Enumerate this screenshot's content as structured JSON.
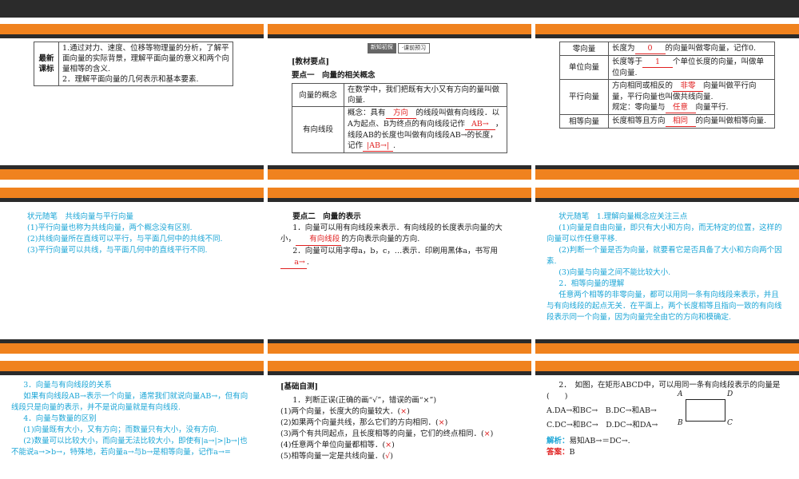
{
  "p1": {
    "label": "最新课标",
    "line1": "1.通过对力、速度、位移等物理量的分析，了解平面向量的实际背景，理解平面向量的意义和两个向量相等的含义.",
    "line2": "2．理解平面向量的几何表示和基本要素."
  },
  "p2": {
    "banner_a": "新知初探",
    "banner_b": "·课前预习",
    "heading": "[教材要点]",
    "point": "要点一　向量的相关概念",
    "row1_h": "向量的概念",
    "row1_v": "在数学中，我们把既有大小又有方向的量叫做向量.",
    "row2_h": "有向线段",
    "row2_a": "概念：具有",
    "row2_fill1": "方向",
    "row2_b": "的线段叫做有向线段．以A为起点、B为终点的有向线段记作",
    "row2_fill2": "AB→",
    "row2_c": "，线段AB的长度也叫做有向线段AB→的长度，记作",
    "row2_fill3": "|AB→|",
    "row2_d": "."
  },
  "p3": {
    "r1_h": "零向量",
    "r1_a": "长度为",
    "r1_f": "0",
    "r1_b": "的向量叫做零向量，记作0.",
    "r2_h": "单位向量",
    "r2_a": "长度等于",
    "r2_f": "1",
    "r2_b": "个单位长度的向量，叫做单位向量.",
    "r3_h": "平行向量",
    "r3_a": "方向相同或相反的",
    "r3_f": "非零",
    "r3_b": "向量叫做平行向量，平行向量也叫做共线向量.",
    "r3_c": "规定：零向量与",
    "r3_f2": "任意",
    "r3_d": "向量平行.",
    "r4_h": "相等向量",
    "r4_a": "长度相等且方向",
    "r4_f": "相同",
    "r4_b": "的向量叫做相等向量."
  },
  "p4": {
    "title": "状元随笔　共线向量与平行向量",
    "l1": "(1)平行向量也称为共线向量，两个概念没有区别.",
    "l2": "(2)共线向量所在直线可以平行，与平面几何中的共线不同.",
    "l3": "(3)平行向量可以共线，与平面几何中的直线平行不同."
  },
  "p5": {
    "title": "要点二　向量的表示",
    "l1a": "1．向量可以用有向线段来表示．有向线段的长度表示向量的大小，",
    "l1f": "有向线段",
    "l1b": "的方向表示向量的方向.",
    "l2": "2．向量可以用字母a，b，c，…表示．印刷用黑体a，书写用",
    "l2f": "a→",
    "l2b": "."
  },
  "p6": {
    "title": "状元随笔　1.理解向量概念应关注三点",
    "l1": "(1)向量是自由向量，即只有大小和方向，而无特定的位置，这样的向量可以作任意平移.",
    "l2": "(2)判断一个量是否为向量，就要看它是否具备了大小和方向两个因素.",
    "l3": "(3)向量与向量之间不能比较大小.",
    "l4": "2．相等向量的理解",
    "l5": "任意两个相等的非零向量，都可以用同一条有向线段来表示，并且与有向线段的起点无关．在平面上，两个长度相等且指向一致的有向线段表示同一个向量，因为向量完全由它的方向和模确定."
  },
  "p7": {
    "l1": "3．向量与有向线段的关系",
    "l2": "如果有向线段AB→表示一个向量，通常我们就说向量AB→，但有向线段只是向量的表示，并不是说向量就是有向线段.",
    "l3": "4．向量与数量的区别",
    "l4": "(1)向量既有大小，又有方向；而数量只有大小，没有方向.",
    "l5": "(2)数量可以比较大小，而向量无法比较大小，即使有|a→|>|b→|也不能说a→>b→，特殊地，若向量a→与b→是相等向量，记作a→="
  },
  "p8": {
    "heading": "[基础自测]",
    "q": "1．判断正误(正确的画“√”，错误的画“×”)",
    "s1": "(1)两个向量，长度大的向量较大．(",
    "a1": "×",
    "s1e": ")",
    "s2": "(2)如果两个向量共线，那么它们的方向相同．(",
    "a2": "×",
    "s2e": ")",
    "s3": "(3)两个有共同起点，且长度相等的向量，它们的终点相同．(",
    "a3": "×",
    "s3e": ")",
    "s4": "(4)任意两个单位向量都相等．(",
    "a4": "×",
    "s4e": ")",
    "s5": "(5)相等向量一定是共线向量．(",
    "a5": "√",
    "s5e": ")"
  },
  "p9": {
    "q": "2．　如图，在矩形ABCD中，可以用同一条有向线段表示的向量是(　　)",
    "oA": "A.DA→和BC→",
    "oB": "B.DC→和AB→",
    "oC": "C.DC→和BC→",
    "oD": "D.DC→和DA→",
    "va": "A",
    "vd": "D",
    "vb": "B",
    "vc": "C",
    "jx_label": "解析：",
    "jx": "易知AB→＝DC→.",
    "ans_label": "答案：",
    "ans": "B"
  },
  "colors": {
    "orange": "#f0821e",
    "dark": "#2b2b2b",
    "blue": "#1aa5d6",
    "red": "#e02020"
  }
}
